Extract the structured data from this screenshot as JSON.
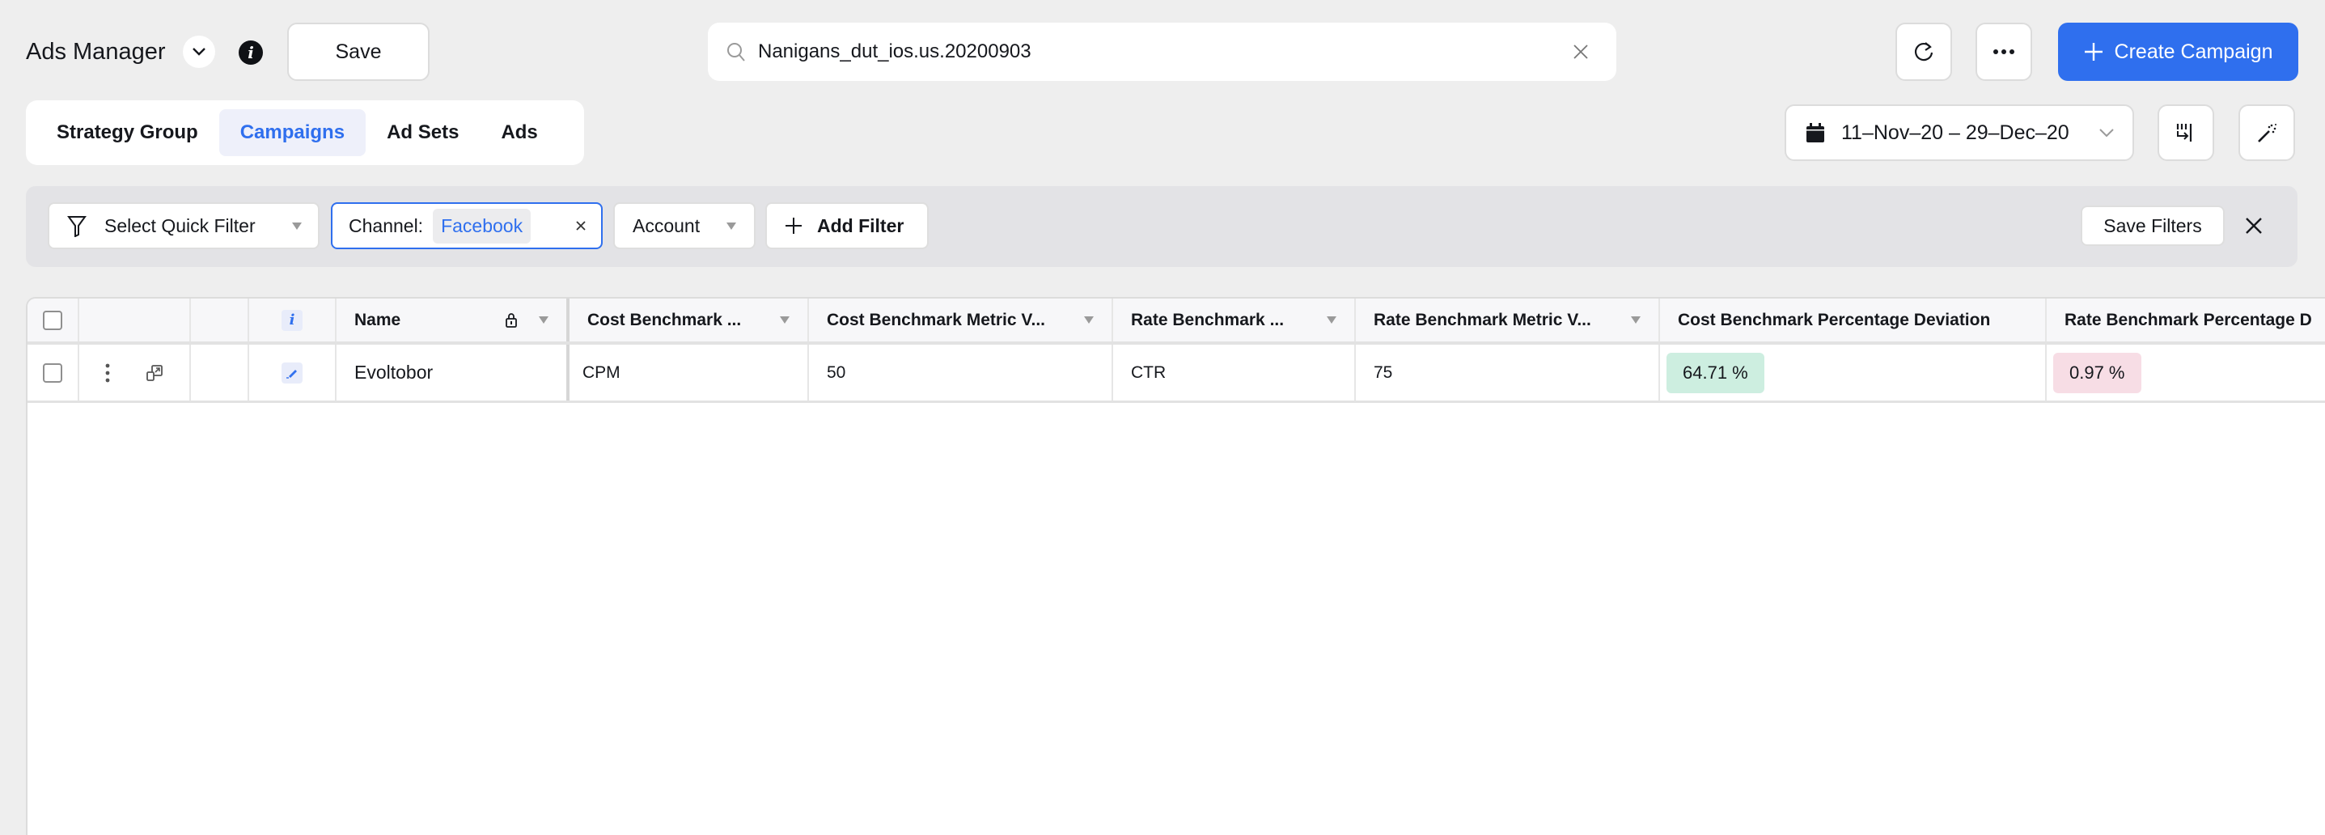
{
  "header": {
    "title": "Ads Manager",
    "save_label": "Save",
    "search": {
      "value": "Nanigans_dut_ios.us.20200903",
      "placeholder": "Search"
    },
    "create_label": "Create Campaign",
    "accent_color": "#2f6fee"
  },
  "tabs": [
    {
      "label": "Strategy Group",
      "active": false
    },
    {
      "label": "Campaigns",
      "active": true
    },
    {
      "label": "Ad Sets",
      "active": false
    },
    {
      "label": "Ads",
      "active": false
    }
  ],
  "date_range": {
    "label": "11–Nov–20 – 29–Dec–20"
  },
  "filters": {
    "quick_filter_label": "Select Quick Filter",
    "channel": {
      "key": "Channel:",
      "value": "Facebook"
    },
    "account_label": "Account",
    "add_filter_label": "Add Filter",
    "save_filters_label": "Save Filters"
  },
  "table": {
    "columns": [
      {
        "label": "Name"
      },
      {
        "label": "Cost Benchmark ..."
      },
      {
        "label": "Cost Benchmark Metric V..."
      },
      {
        "label": "Rate Benchmark ..."
      },
      {
        "label": "Rate Benchmark Metric V..."
      },
      {
        "label": "Cost Benchmark Percentage Deviation"
      },
      {
        "label": "Rate Benchmark Percentage D"
      }
    ],
    "rows": [
      {
        "name": "Evoltobor",
        "cost_benchmark": "CPM",
        "cost_benchmark_metric_value": "50",
        "rate_benchmark": "CTR",
        "rate_benchmark_metric_value": "75",
        "cost_benchmark_pct_deviation": "64.71 %",
        "rate_benchmark_pct_deviation": "0.97 %"
      }
    ],
    "status_colors": {
      "positive": "#cdeee0",
      "negative": "#f7dde5"
    }
  }
}
